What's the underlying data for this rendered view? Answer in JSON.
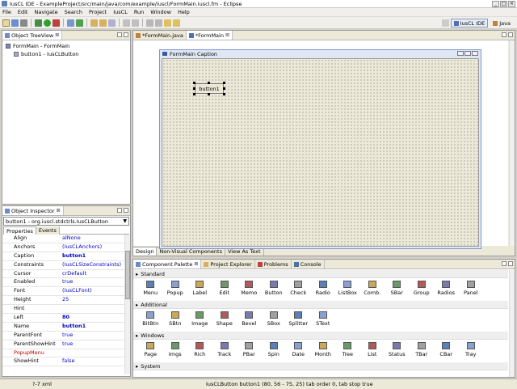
{
  "window": {
    "title": "IusCL IDE - ExampleProject/src/main/java/com/example/iuscl/FormMain.iuscl.fm - Eclipse"
  },
  "menu": [
    "File",
    "Edit",
    "Navigate",
    "Search",
    "Project",
    "IusCL",
    "Run",
    "Window",
    "Help"
  ],
  "perspectives": {
    "active": "IusCL IDE",
    "other": "Java"
  },
  "tree_view": {
    "tab": "Object TreeView",
    "nodes": [
      "FormMain - FormMain",
      "button1 - IusCLButton"
    ]
  },
  "editor": {
    "tabs": [
      "*FormMain.java",
      "*FormMain"
    ],
    "form_caption": "FormMain Caption",
    "button_caption": "button1",
    "bottom_tabs": [
      "Design",
      "Non-Visual Components",
      "View As Text"
    ]
  },
  "inspector": {
    "tab": "Object Inspector",
    "selected": "button1 - org.iuscl.stdctrls.IusCLButton",
    "tabs": [
      "Properties",
      "Events"
    ],
    "props": [
      {
        "name": "Align",
        "value": "alNone"
      },
      {
        "name": "Anchors",
        "value": "(IusCLAnchors)"
      },
      {
        "name": "Caption",
        "value": "button1"
      },
      {
        "name": "Constraints",
        "value": "(IusCLSizeConstraints)"
      },
      {
        "name": "Cursor",
        "value": "crDefault"
      },
      {
        "name": "Enabled",
        "value": "true"
      },
      {
        "name": "Font",
        "value": "(IusCLFont)"
      },
      {
        "name": "Height",
        "value": "25"
      },
      {
        "name": "Hint",
        "value": ""
      },
      {
        "name": "Left",
        "value": "80"
      },
      {
        "name": "Name",
        "value": "button1"
      },
      {
        "name": "ParentFont",
        "value": "true"
      },
      {
        "name": "ParentShowHint",
        "value": "true"
      },
      {
        "name": "PopupMenu",
        "value": ""
      },
      {
        "name": "ShowHint",
        "value": "false"
      }
    ]
  },
  "bottom_views": [
    "Component Palette",
    "Project Explorer",
    "Problems",
    "Console"
  ],
  "palette": {
    "groups": [
      {
        "name": "Standard",
        "items": [
          "Menu",
          "Popup",
          "Label",
          "Edit",
          "Memo",
          "Button",
          "Check",
          "Radio",
          "ListBox",
          "Comb.",
          "SBar",
          "Group",
          "Radios",
          "Panel"
        ]
      },
      {
        "name": "Additional",
        "items": [
          "BitBtn",
          "SBtn",
          "Image",
          "Shape",
          "Bevel",
          "SBox",
          "Splitter",
          "SText"
        ]
      },
      {
        "name": "Windows",
        "items": [
          "Page",
          "Imgs",
          "Rich",
          "Track",
          "PBar",
          "Spin",
          "Date",
          "Month",
          "Tree",
          "List",
          "Status",
          "TBar",
          "CBar",
          "Tray"
        ]
      },
      {
        "name": "System",
        "items": []
      }
    ]
  },
  "status": {
    "left": "?-7 xml",
    "message": "IusCLButton button1 (80, 56 - 75, 25) tab order 0, tab stop true"
  },
  "colors": {
    "accent": "#7a96cf",
    "prop_value": "#0000c0",
    "prop_highlight": "#c00000"
  }
}
